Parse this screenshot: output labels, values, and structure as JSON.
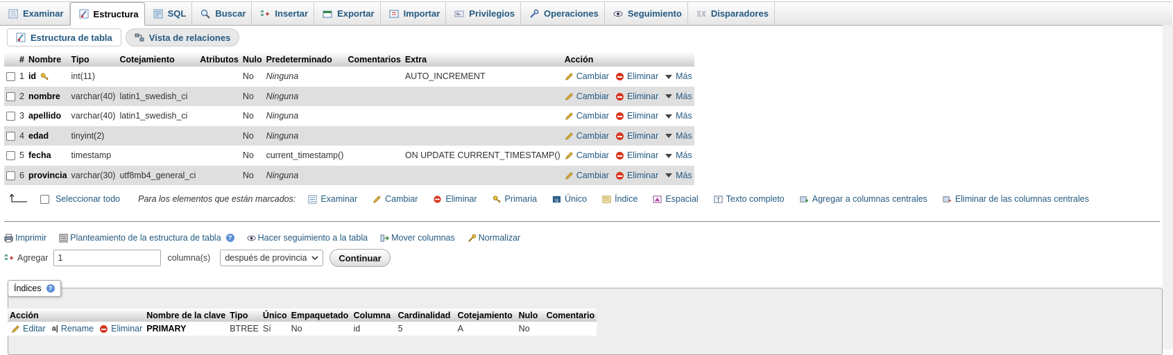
{
  "tabs": [
    {
      "label": "Examinar",
      "icon": "browse-icon"
    },
    {
      "label": "Estructura",
      "icon": "structure-icon",
      "active": true
    },
    {
      "label": "SQL",
      "icon": "sql-icon"
    },
    {
      "label": "Buscar",
      "icon": "search-icon"
    },
    {
      "label": "Insertar",
      "icon": "insert-icon"
    },
    {
      "label": "Exportar",
      "icon": "export-icon"
    },
    {
      "label": "Importar",
      "icon": "import-icon"
    },
    {
      "label": "Privilegios",
      "icon": "privileges-icon"
    },
    {
      "label": "Operaciones",
      "icon": "wrench-icon"
    },
    {
      "label": "Seguimiento",
      "icon": "eye-icon"
    },
    {
      "label": "Disparadores",
      "icon": "triggers-icon"
    }
  ],
  "subtabs": {
    "table_structure": "Estructura de tabla",
    "relation_view": "Vista de relaciones"
  },
  "structure": {
    "headers": {
      "num": "#",
      "name": "Nombre",
      "type": "Tipo",
      "collation": "Cotejamiento",
      "attributes": "Atributos",
      "null": "Nulo",
      "default": "Predeterminado",
      "comments": "Comentarios",
      "extra": "Extra",
      "action": "Acción"
    },
    "rows": [
      {
        "num": "1",
        "name": "id",
        "key": true,
        "type": "int(11)",
        "collation": "",
        "null": "No",
        "default": "Ninguna",
        "default_italic": true,
        "extra": "AUTO_INCREMENT"
      },
      {
        "num": "2",
        "name": "nombre",
        "key": false,
        "type": "varchar(40)",
        "collation": "latin1_swedish_ci",
        "null": "No",
        "default": "Ninguna",
        "default_italic": true,
        "extra": ""
      },
      {
        "num": "3",
        "name": "apellido",
        "key": false,
        "type": "varchar(40)",
        "collation": "latin1_swedish_ci",
        "null": "No",
        "default": "Ninguna",
        "default_italic": true,
        "extra": ""
      },
      {
        "num": "4",
        "name": "edad",
        "key": false,
        "type": "tinyint(2)",
        "collation": "",
        "null": "No",
        "default": "Ninguna",
        "default_italic": true,
        "extra": ""
      },
      {
        "num": "5",
        "name": "fecha",
        "key": false,
        "type": "timestamp",
        "collation": "",
        "null": "No",
        "default": "current_timestamp()",
        "default_italic": false,
        "extra": "ON UPDATE CURRENT_TIMESTAMP()"
      },
      {
        "num": "6",
        "name": "provincia",
        "key": false,
        "type": "varchar(30)",
        "collation": "utf8mb4_general_ci",
        "null": "No",
        "default": "Ninguna",
        "default_italic": true,
        "extra": ""
      }
    ],
    "actions": {
      "change": "Cambiar",
      "drop": "Eliminar",
      "more": "Más"
    }
  },
  "bulk": {
    "select_all": "Seleccionar todo",
    "with_selected": "Para los elementos que están marcados:",
    "items": [
      {
        "label": "Examinar",
        "icon": "browse-icon"
      },
      {
        "label": "Cambiar",
        "icon": "pencil-icon"
      },
      {
        "label": "Eliminar",
        "icon": "drop-icon"
      },
      {
        "label": "Primaria",
        "icon": "key-icon"
      },
      {
        "label": "Único",
        "icon": "unique-icon"
      },
      {
        "label": "Índice",
        "icon": "index-icon"
      },
      {
        "label": "Espacial",
        "icon": "spatial-icon"
      },
      {
        "label": "Texto completo",
        "icon": "fulltext-icon"
      },
      {
        "label": "Agregar a columnas centrales",
        "icon": "central-add-icon"
      },
      {
        "label": "Eliminar de las columnas centrales",
        "icon": "central-remove-icon"
      }
    ]
  },
  "tools": [
    {
      "label": "Imprimir",
      "icon": "print-icon"
    },
    {
      "label": "Planteamiento de la estructura de tabla",
      "icon": "propose-structure-icon",
      "help": true
    },
    {
      "label": "Hacer seguimiento a la tabla",
      "icon": "eye-icon"
    },
    {
      "label": "Mover columnas",
      "icon": "move-columns-icon"
    },
    {
      "label": "Normalizar",
      "icon": "normalize-icon"
    }
  ],
  "add": {
    "label": "Agregar",
    "value": "1",
    "columns_label": "columna(s)",
    "position": "después de provincia",
    "button": "Continuar"
  },
  "indexes": {
    "legend": "Índices",
    "headers": {
      "action": "Acción",
      "key_name": "Nombre de la clave",
      "type": "Tipo",
      "unique": "Único",
      "packed": "Empaquetado",
      "column": "Columna",
      "cardinality": "Cardinalidad",
      "collation": "Cotejamiento",
      "null": "Nulo",
      "comment": "Comentario"
    },
    "rows": [
      {
        "edit": "Editar",
        "rename": "Rename",
        "drop": "Eliminar",
        "key_name": "PRIMARY",
        "type": "BTREE",
        "unique": "Sí",
        "packed": "No",
        "column": "id",
        "cardinality": "5",
        "collation": "A",
        "null": "No",
        "comment": ""
      }
    ]
  }
}
